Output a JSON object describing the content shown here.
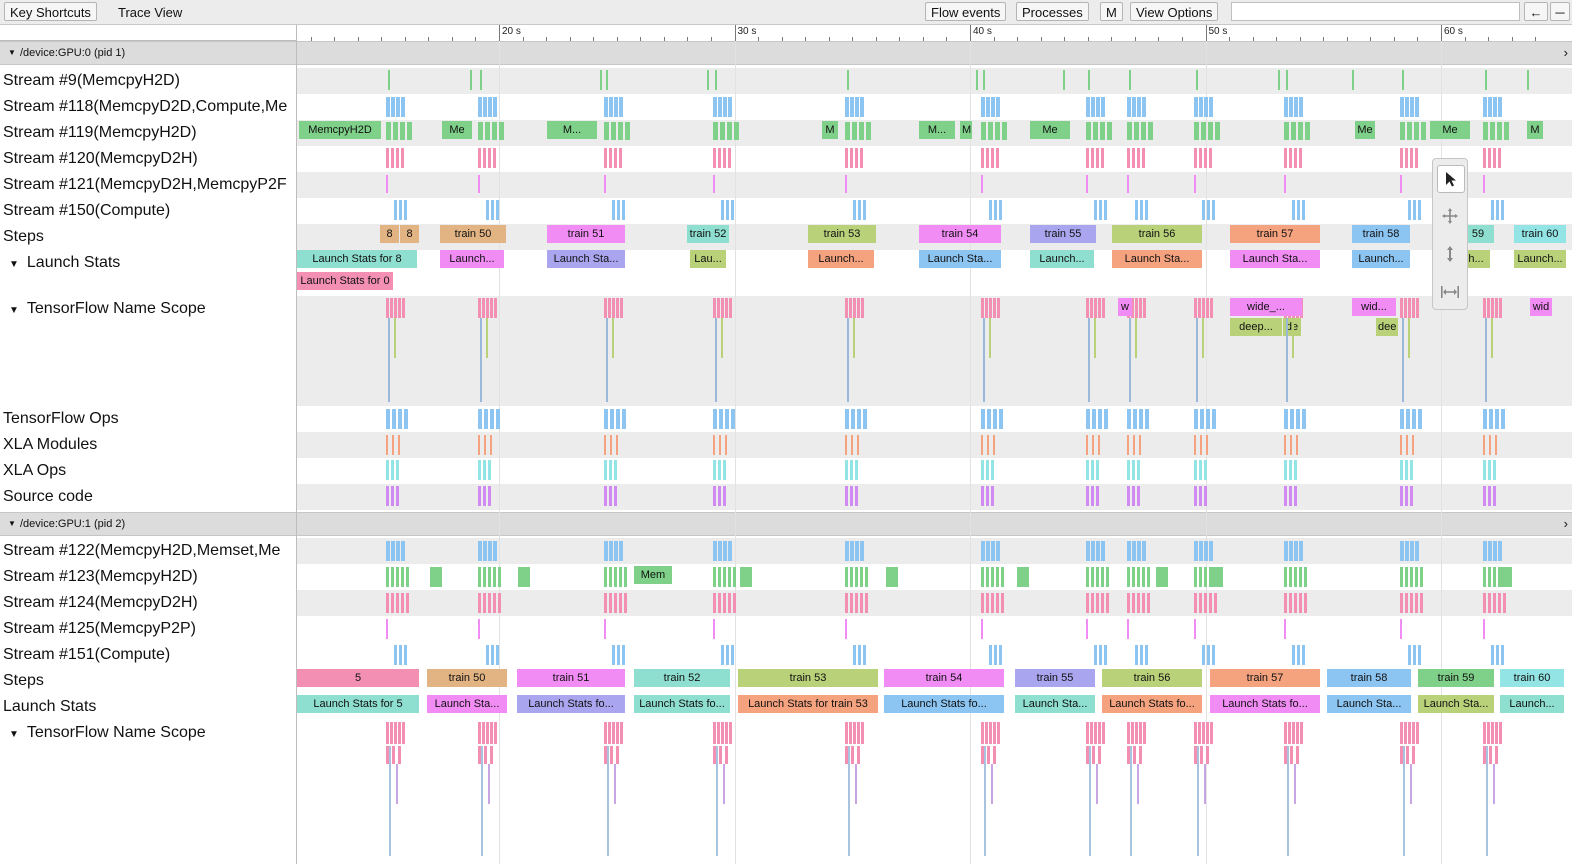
{
  "toolbar": {
    "key_shortcuts": "Key Shortcuts",
    "trace_view": "Trace View",
    "flow_events": "Flow events",
    "processes": "Processes",
    "m": "M",
    "view_options": "View Options",
    "left_arrow": "←",
    "more": "─"
  },
  "ruler": {
    "ticks": [
      {
        "label": "20 s",
        "t": 20
      },
      {
        "label": "30 s",
        "t": 30
      },
      {
        "label": "40 s",
        "t": 40
      },
      {
        "label": "50 s",
        "t": 50
      },
      {
        "label": "60 s",
        "t": 60
      }
    ]
  },
  "processes": [
    {
      "title": "/device:GPU:0 (pid 1)",
      "tracks": [
        {
          "label": "Stream #9(MemcpyH2D)",
          "alt": true
        },
        {
          "label": "Stream #118(MemcpyD2D,Compute,Me",
          "alt": false
        },
        {
          "label": "Stream #119(MemcpyH2D)",
          "alt": true
        },
        {
          "label": "Stream #120(MemcpyD2H)",
          "alt": false
        },
        {
          "label": "Stream #121(MemcpyD2H,MemcpyP2F",
          "alt": true
        },
        {
          "label": "Stream #150(Compute)",
          "alt": false
        },
        {
          "label": "Steps",
          "alt": true
        },
        {
          "label": "Launch Stats",
          "alt": false,
          "expandable": true
        },
        {
          "label": "TensorFlow Name Scope",
          "alt": true,
          "expandable": true
        },
        {
          "label": "TensorFlow Ops",
          "alt": false
        },
        {
          "label": "XLA Modules",
          "alt": true
        },
        {
          "label": "XLA Ops",
          "alt": false
        },
        {
          "label": "Source code",
          "alt": true
        }
      ]
    },
    {
      "title": "/device:GPU:1 (pid 2)",
      "tracks": [
        {
          "label": "Stream #122(MemcpyH2D,Memset,Me",
          "alt": true
        },
        {
          "label": "Stream #123(MemcpyH2D)",
          "alt": false
        },
        {
          "label": "Stream #124(MemcpyD2H)",
          "alt": true
        },
        {
          "label": "Stream #125(MemcpyP2P)",
          "alt": false
        },
        {
          "label": "Stream #151(Compute)",
          "alt": false
        },
        {
          "label": "Steps",
          "alt": false
        },
        {
          "label": "Launch Stats",
          "alt": false
        },
        {
          "label": "TensorFlow Name Scope",
          "alt": false,
          "expandable": true
        }
      ]
    }
  ],
  "events": {
    "gpu0_stream119": [
      "MemcpyH2D",
      "Me",
      "M...",
      "M",
      "M...",
      "M",
      "Me",
      "Me",
      "Me",
      "M"
    ],
    "gpu0_steps": [
      "8",
      "8",
      "train 50",
      "train 51",
      "train 52",
      "train 53",
      "train 54",
      "train 55",
      "train 56",
      "train 57",
      "train 58",
      "59",
      "train 60"
    ],
    "gpu0_launch_stats": [
      "Launch Stats for 8",
      "Launch...",
      "Launch Sta...",
      "Lau...",
      "Launch...",
      "Launch Sta...",
      "Launch...",
      "Launch Sta...",
      "Launch Sta...",
      "Launch...",
      "h...",
      "Launch..."
    ],
    "gpu0_launch_stats_row2": [
      "Launch Stats for 0"
    ],
    "gpu0_name_scope": [
      "w",
      "wide_...",
      "wid...",
      "wid"
    ],
    "gpu0_name_scope_row2": [
      "deep...",
      "de",
      "dee"
    ],
    "gpu1_stream123": [
      "Mem"
    ],
    "gpu1_steps": [
      "5",
      "train 50",
      "train 51",
      "train 52",
      "train 53",
      "train 54",
      "train 55",
      "train 56",
      "train 57",
      "train 58",
      "train 59",
      "train 60"
    ],
    "gpu1_launch_stats": [
      "Launch Stats for 5",
      "Launch Sta...",
      "Launch Stats fo...",
      "Launch Stats fo...",
      "Launch Stats for train 53",
      "Launch Stats fo...",
      "Launch Sta...",
      "Launch Stats fo...",
      "Launch Stats fo...",
      "Launch Sta...",
      "Launch Sta...",
      "Launch..."
    ]
  },
  "colors": {
    "green": "#7fd18a",
    "blue": "#8cc4f2",
    "pink": "#f28fb2",
    "magenta": "#f28cf5",
    "tan": "#e3b483",
    "teal": "#8edfd0",
    "olive": "#b9d27a",
    "lavender": "#a9a6ef",
    "salmon": "#f5a27f",
    "violet": "#d28af3",
    "cyan": "#93e4e4"
  },
  "tools": [
    "cursor-select-icon",
    "pan-move-icon",
    "zoom-vertical-icon",
    "timing-range-icon"
  ]
}
